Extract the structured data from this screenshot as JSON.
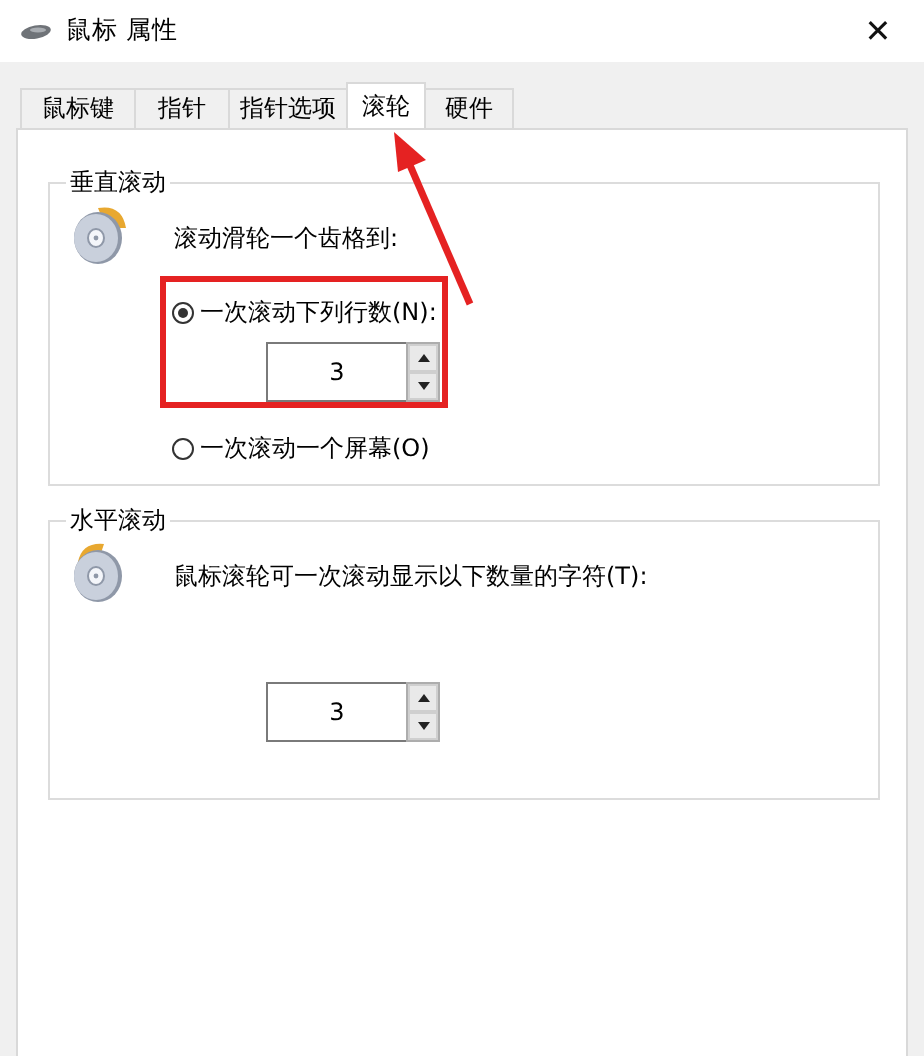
{
  "window": {
    "title": "鼠标 属性",
    "close": "✕"
  },
  "tabs": [
    {
      "label": "鼠标键",
      "selected": false
    },
    {
      "label": "指针",
      "selected": false
    },
    {
      "label": "指针选项",
      "selected": false
    },
    {
      "label": "滚轮",
      "selected": true
    },
    {
      "label": "硬件",
      "selected": false
    }
  ],
  "vertical_scrolling": {
    "title": "垂直滚动",
    "prompt": "滚动滑轮一个齿格到:",
    "options": [
      {
        "label": "一次滚动下列行数(N):",
        "selected": true,
        "spinner": {
          "value": "3"
        }
      },
      {
        "label": "一次滚动一个屏幕(O)",
        "selected": false
      }
    ]
  },
  "horizontal_scrolling": {
    "title": "水平滚动",
    "prompt": "鼠标滚轮可一次滚动显示以下数量的字符(T):",
    "spinner": {
      "value": "3"
    }
  },
  "annotation": {
    "highlight": true,
    "arrow": true
  }
}
